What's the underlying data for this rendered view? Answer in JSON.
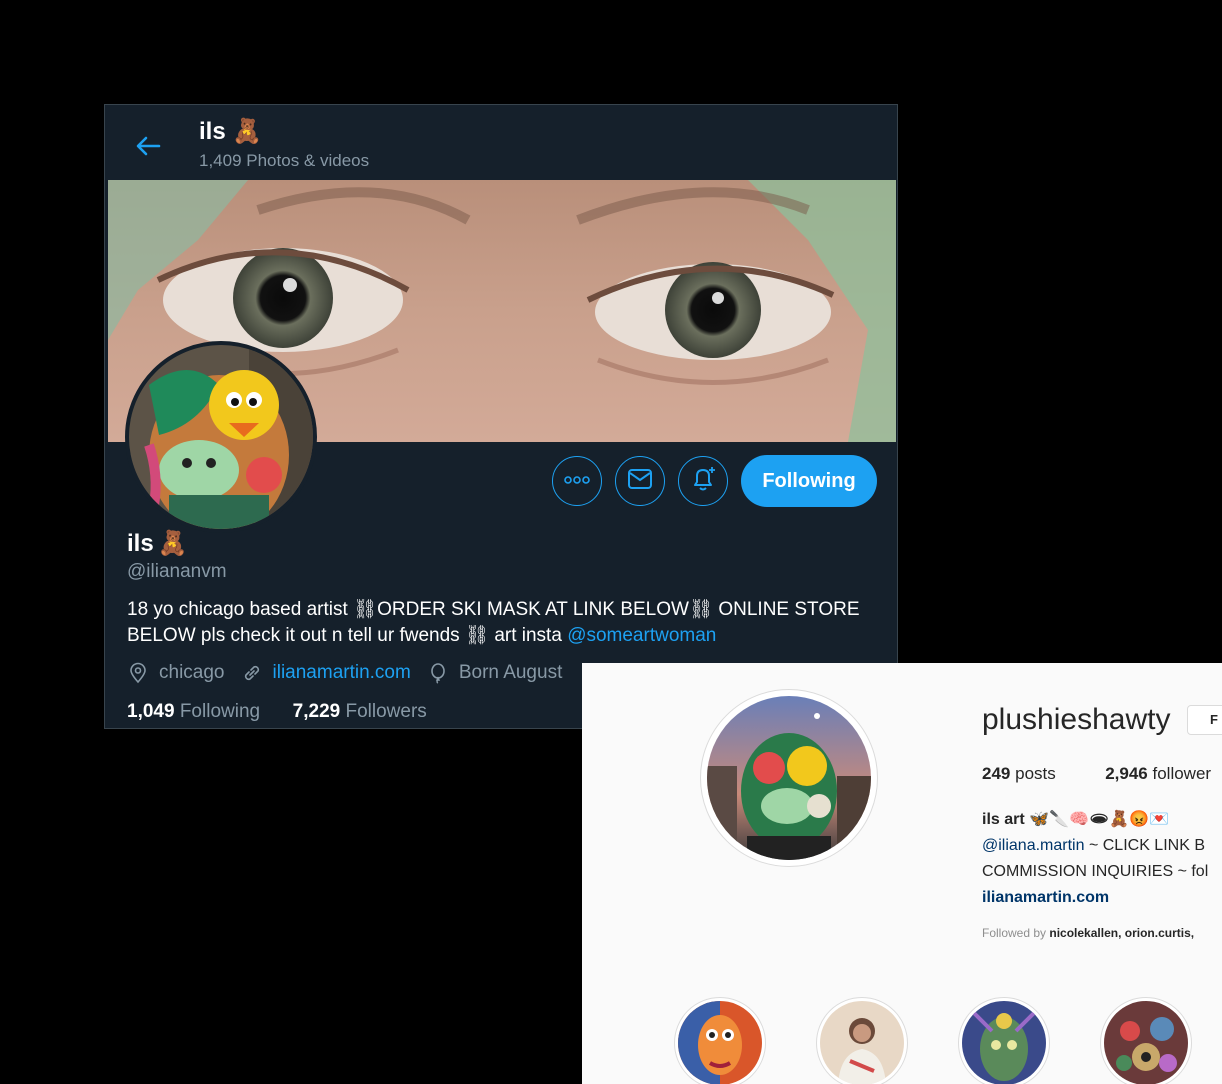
{
  "twitter": {
    "header": {
      "title": "ils",
      "subtitle": "1,409 Photos & videos"
    },
    "profile": {
      "name": "ils",
      "handle": "@iliananvm",
      "bio_text": "18 yo chicago based artist ⛓ORDER SKI MASK AT LINK BELOW⛓ ONLINE STORE BELOW pls check it out n tell ur fwends ⛓ art insta ",
      "bio_link": "@someartwoman",
      "location": "chicago",
      "website": "ilianamartin.com",
      "born": "Born August",
      "following_count": "1,049",
      "following_label": "Following",
      "followers_count": "7,229",
      "followers_label": "Followers"
    },
    "actions": {
      "follow_label": "Following"
    },
    "colors": {
      "bg": "#15202b",
      "accent": "#1da1f2",
      "muted": "#8899a6"
    },
    "icons": [
      "back-arrow-icon",
      "more-icon",
      "mail-icon",
      "bell-plus-icon",
      "location-icon",
      "link-icon",
      "balloon-icon",
      "teddy-bear-emoji"
    ]
  },
  "instagram": {
    "username": "plushieshawty",
    "button_label": "F",
    "posts_count": "249",
    "posts_label": "posts",
    "followers_count": "2,946",
    "followers_label": "follower",
    "bio_name": "ils art 🦋🔪🧠🕳🧸😡💌",
    "bio_mention": "@iliana.martin",
    "bio_line1_rest": " ~ CLICK LINK B",
    "bio_line2": "COMMISSION INQUIRIES ~ fol",
    "website": "ilianamartin.com",
    "followed_prefix": "Followed by ",
    "followed_names": "nicolekallen, orion.curtis,",
    "colors": {
      "bg": "#fafafa",
      "link": "#003569",
      "muted": "#8e8e8e"
    }
  }
}
